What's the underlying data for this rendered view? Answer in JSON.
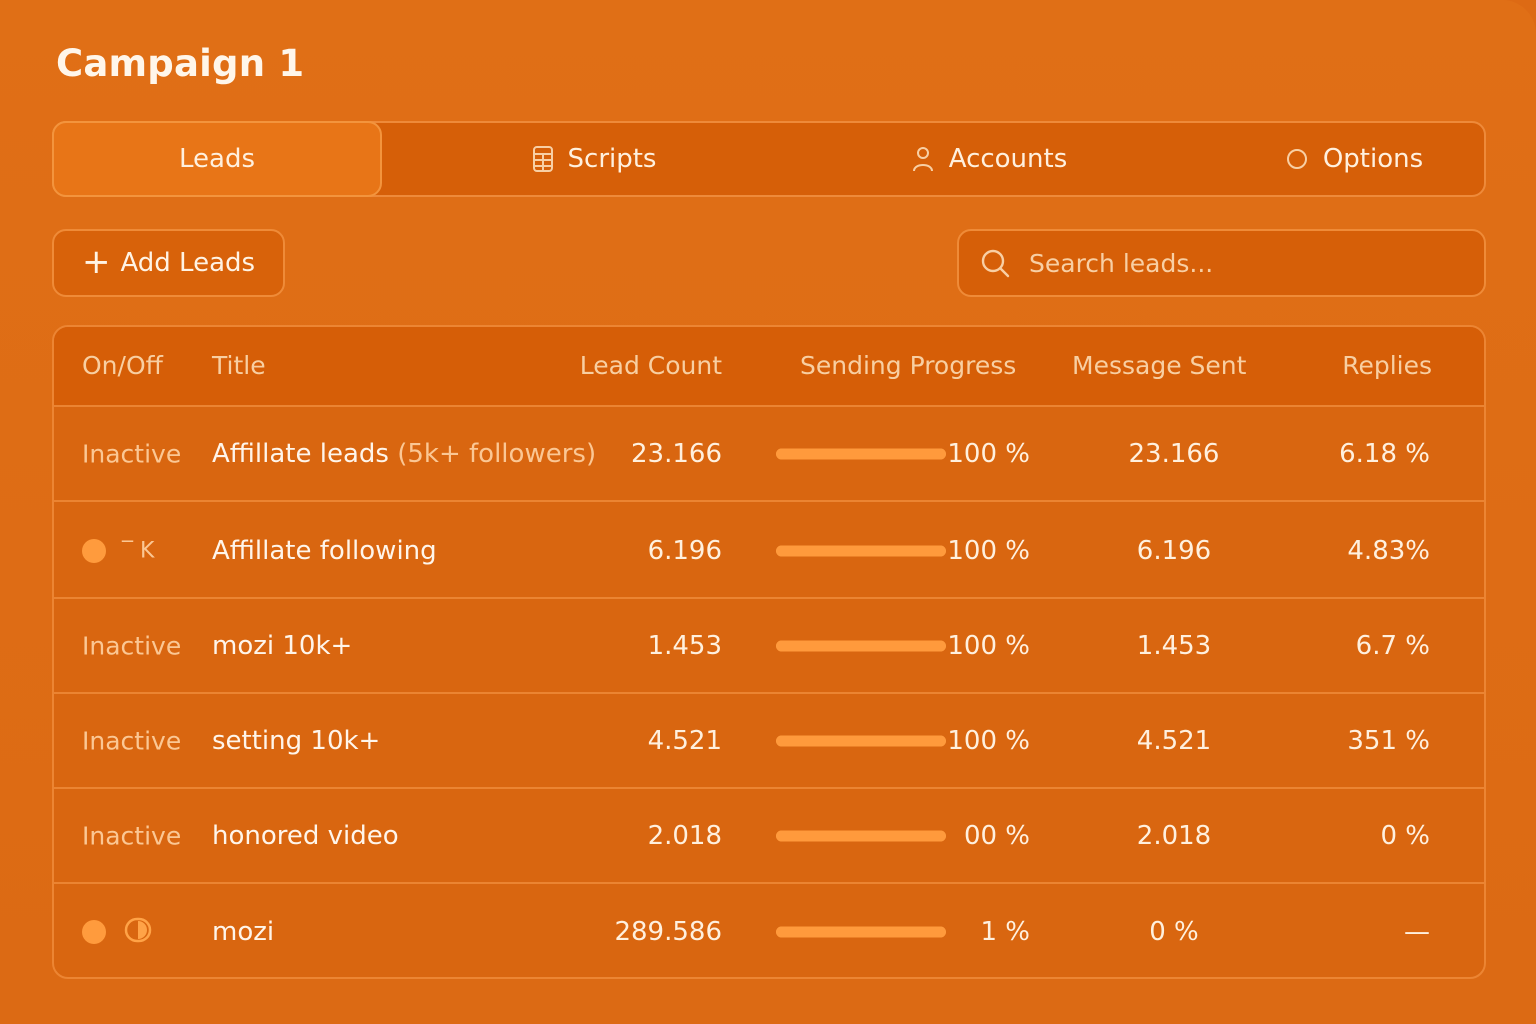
{
  "page": {
    "title": "Campaign 1"
  },
  "tabs": [
    {
      "label": "Leads",
      "icon": "",
      "active": true
    },
    {
      "label": "Scripts",
      "icon": "calculator-icon",
      "active": false
    },
    {
      "label": "Accounts",
      "icon": "user-icon",
      "active": false
    },
    {
      "label": "Options",
      "icon": "circle-icon",
      "active": false
    }
  ],
  "toolbar": {
    "add_label": "Add Leads",
    "add_icon": "plus-icon",
    "search_placeholder": "Search leads..."
  },
  "table": {
    "headers": [
      "On/Off",
      "Title",
      "Lead Count",
      "Sending Progress",
      "Message Sent",
      "Replies"
    ],
    "rows": [
      {
        "status": "Inactive",
        "status_type": "text",
        "title": "Affillate leads",
        "title_sub": "(5k+ followers)",
        "lead_count": "23.166",
        "progress": 1.0,
        "progress_label": "100 %",
        "message_sent": "23.166",
        "replies": "6.18 %"
      },
      {
        "status": "",
        "status_type": "dot-glyph",
        "status_glyph": "‾ K",
        "title": "Affillate following",
        "title_sub": "",
        "lead_count": "6.196",
        "progress": 1.0,
        "progress_label": "100 %",
        "message_sent": "6.196",
        "replies": "4.83%"
      },
      {
        "status": "Inactive",
        "status_type": "text",
        "title": "mozi 10k+",
        "title_sub": "",
        "lead_count": "1.453",
        "progress": 1.0,
        "progress_label": "100 %",
        "message_sent": "1.453",
        "replies": "6.7 %"
      },
      {
        "status": "Inactive",
        "status_type": "text",
        "title": "setting 10k+",
        "title_sub": "",
        "lead_count": "4.521",
        "progress": 1.0,
        "progress_label": "100 %",
        "message_sent": "4.521",
        "replies": "351 %"
      },
      {
        "status": "Inactive",
        "status_type": "text",
        "title": "honored video",
        "title_sub": "",
        "lead_count": "2.018",
        "progress": 1.0,
        "progress_label": "00 %",
        "message_sent": "2.018",
        "replies": "0 %"
      },
      {
        "status": "",
        "status_type": "dot-toggle",
        "title": "mozi",
        "title_sub": "",
        "lead_count": "289.586",
        "progress": 1.0,
        "progress_label": "1 %",
        "message_sent": "0 %",
        "replies": "—"
      }
    ]
  },
  "colors": {
    "background": "#dd6a14",
    "panel": "#d65f08",
    "border": "#ef8b38",
    "accent": "#ff9b3d",
    "muted_text": "#fbc794"
  }
}
